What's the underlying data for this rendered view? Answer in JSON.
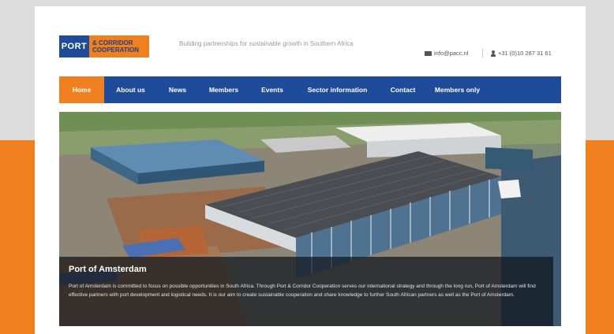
{
  "colors": {
    "brand_blue": "#1e4c9a",
    "brand_orange": "#f07f1f"
  },
  "logo": {
    "port": "PORT",
    "line1": "& CORRIDOR",
    "line2": "COOPERATION"
  },
  "header": {
    "tagline": "Building partnerships for sustainable growth in Southern Africa",
    "email": "info@pacc.nl",
    "phone": "+31 (0)10 287 31 61",
    "email_icon": "envelope-icon",
    "phone_icon": "person-icon"
  },
  "nav": {
    "items": [
      {
        "label": "Home",
        "active": true
      },
      {
        "label": "About us"
      },
      {
        "label": "News"
      },
      {
        "label": "Members"
      },
      {
        "label": "Events"
      },
      {
        "label": "Sector information"
      },
      {
        "label": "Contact"
      },
      {
        "label": "Members only"
      }
    ]
  },
  "hero": {
    "title": "Port of Amsterdam",
    "text": "Port of Amsterdam is committed to focus on possible opportunities in South Africa. Through Port & Corridor Cooperation serves our international strategy and through the long run, Port of Amsterdam will find effective partners with port development and logistical needs. It is our aim to create sustainable cooperation and share knowledge to further South African partners as well as the Port of Amsterdam."
  }
}
